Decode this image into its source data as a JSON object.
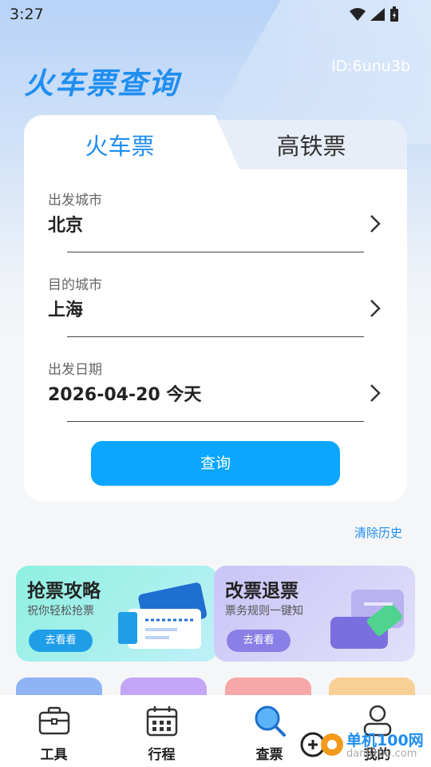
{
  "status_bar": {
    "time": "3:27"
  },
  "header": {
    "title": "火车票查询",
    "user_id": "ID:6unu3b"
  },
  "tabs": [
    {
      "label": "火车票",
      "active": true
    },
    {
      "label": "高铁票",
      "active": false
    }
  ],
  "form": {
    "fields": [
      {
        "label": "出发城市",
        "value": "北京"
      },
      {
        "label": "目的城市",
        "value": "上海"
      },
      {
        "label": "出发日期",
        "value": "2026-04-20 今天"
      }
    ],
    "query_label": "查询"
  },
  "clear_history": "清除历史",
  "promos": [
    {
      "title": "抢票攻略",
      "subtitle": "祝你轻松抢票",
      "button": "去看看"
    },
    {
      "title": "改票退票",
      "subtitle": "票务规则一键知",
      "button": "去看看"
    }
  ],
  "bottom_nav": [
    {
      "label": "工具",
      "icon": "toolbox-icon"
    },
    {
      "label": "行程",
      "icon": "calendar-icon"
    },
    {
      "label": "查票",
      "icon": "search-icon",
      "active": true
    },
    {
      "label": "我的",
      "icon": "user-icon"
    }
  ],
  "watermark": {
    "text": "单机100网",
    "sub": "danji100.com"
  },
  "colors": {
    "accent": "#1f8ef0",
    "button": "#0aa6ff"
  }
}
